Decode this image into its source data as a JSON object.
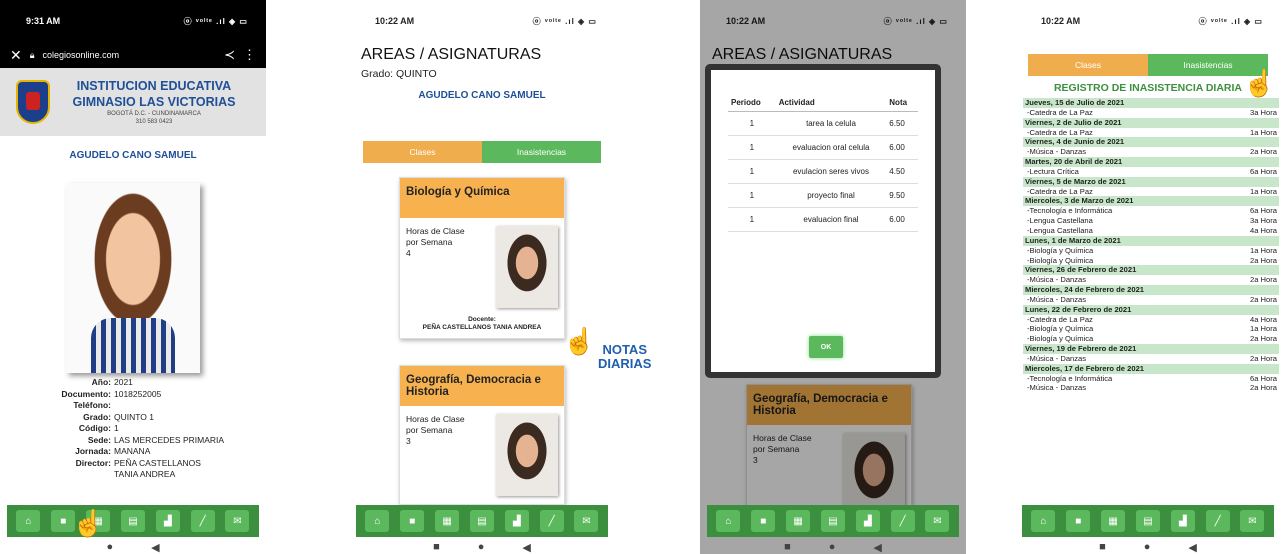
{
  "p1": {
    "time": "9:31 AM",
    "status_icons": "ⓞ ᵛᵒˡᵗᵉ .ıl ◈ ▭",
    "url": "colegiosonline.com",
    "school": {
      "line1": "INSTITUCION EDUCATIVA",
      "line2": "GIMNASIO LAS VICTORIAS",
      "line3": "BOGOTÁ D.C. - CUNDINAMARCA",
      "line4": "310 583 0423"
    },
    "student": "AGUDELO CANO SAMUEL",
    "info": [
      {
        "k": "Año:",
        "v": "2021"
      },
      {
        "k": "Documento:",
        "v": "1018252005"
      },
      {
        "k": "Teléfono:",
        "v": ""
      },
      {
        "k": "Grado:",
        "v": "QUINTO 1"
      },
      {
        "k": "Código:",
        "v": "1"
      },
      {
        "k": "Sede:",
        "v": "LAS MERCEDES PRIMARIA"
      },
      {
        "k": "Jornada:",
        "v": "MANANA"
      },
      {
        "k": "Director:",
        "v": "PEÑA CASTELLANOS"
      },
      {
        "k": "",
        "v": "TANIA ANDREA"
      }
    ]
  },
  "p2": {
    "time": "10:22 AM",
    "title": "AREAS / ASIGNATURAS",
    "grado": "Grado: QUINTO",
    "student": "AGUDELO CANO SAMUEL",
    "tab_clases": "Clases",
    "tab_inasistencias": "Inasistencias",
    "card1": {
      "subject": "Biología y Química",
      "hours_label1": "Horas de Clase",
      "hours_label2": "por Semana",
      "hours": "4",
      "docente_label": "Docente:",
      "docente": "PEÑA CASTELLANOS TANIA ANDREA"
    },
    "card2": {
      "subject": "Geografía, Democracia e Historia",
      "hours_label1": "Horas de Clase",
      "hours_label2": "por Semana",
      "hours": "3"
    },
    "notas_line1": "NOTAS",
    "notas_line2": "DIARIAS"
  },
  "p3": {
    "time": "10:22 AM",
    "title": "AREAS / ASIGNATURAS",
    "headers": {
      "periodo": "Periodo",
      "actividad": "Actividad",
      "nota": "Nota"
    },
    "rows": [
      {
        "p": "1",
        "a": "tarea la celula",
        "n": "6.50"
      },
      {
        "p": "1",
        "a": "evaluacion oral celula",
        "n": "6.00"
      },
      {
        "p": "1",
        "a": "evulacion seres vivos",
        "n": "4.50"
      },
      {
        "p": "1",
        "a": "proyecto final",
        "n": "9.50"
      },
      {
        "p": "1",
        "a": "evaluacion final",
        "n": "6.00"
      }
    ],
    "ok": "OK",
    "card": {
      "subject": "Geografía, Democracia e Historia",
      "hours_label1": "Horas de Clase",
      "hours_label2": "por Semana",
      "hours": "3"
    }
  },
  "p4": {
    "time": "10:22 AM",
    "tab_clases": "Clases",
    "tab_inasistencias": "Inasistencias",
    "title": "REGISTRO DE INASISTENCIA DIARIA",
    "records": [
      {
        "t": "d",
        "text": "Jueves, 15 de Julio de 2021"
      },
      {
        "t": "e",
        "text": "-Catedra de La Paz",
        "h": "3a Hora"
      },
      {
        "t": "d",
        "text": "Viernes, 2 de Julio de 2021"
      },
      {
        "t": "e",
        "text": "-Catedra de La Paz",
        "h": "1a Hora"
      },
      {
        "t": "d",
        "text": "Viernes, 4 de Junio de 2021"
      },
      {
        "t": "e",
        "text": "-Música - Danzas",
        "h": "2a Hora"
      },
      {
        "t": "d",
        "text": "Martes, 20 de Abril de 2021"
      },
      {
        "t": "e",
        "text": "-Lectura Crítica",
        "h": "6a Hora"
      },
      {
        "t": "d",
        "text": "Viernes, 5 de Marzo de 2021"
      },
      {
        "t": "e",
        "text": "-Catedra de La Paz",
        "h": "1a Hora"
      },
      {
        "t": "d",
        "text": "Miercoles, 3 de Marzo de 2021"
      },
      {
        "t": "e",
        "text": "-Tecnología e Informática",
        "h": "6a Hora"
      },
      {
        "t": "e",
        "text": "-Lengua Castellana",
        "h": "3a Hora"
      },
      {
        "t": "e",
        "text": "-Lengua Castellana",
        "h": "4a Hora"
      },
      {
        "t": "d",
        "text": "Lunes, 1 de Marzo de 2021"
      },
      {
        "t": "e",
        "text": "-Biología y Química",
        "h": "1a Hora"
      },
      {
        "t": "e",
        "text": "-Biología y Química",
        "h": "2a Hora"
      },
      {
        "t": "d",
        "text": "Viernes, 26 de Febrero de 2021"
      },
      {
        "t": "e",
        "text": "-Música - Danzas",
        "h": "2a Hora"
      },
      {
        "t": "d",
        "text": "Miercoles, 24 de Febrero de 2021"
      },
      {
        "t": "e",
        "text": "-Música - Danzas",
        "h": "2a Hora"
      },
      {
        "t": "d",
        "text": "Lunes, 22 de Febrero de 2021"
      },
      {
        "t": "e",
        "text": "-Catedra de La Paz",
        "h": "4a Hora"
      },
      {
        "t": "e",
        "text": "-Biología y Química",
        "h": "1a Hora"
      },
      {
        "t": "e",
        "text": "-Biología y Química",
        "h": "2a Hora"
      },
      {
        "t": "d",
        "text": "Viernes, 19 de Febrero de 2021"
      },
      {
        "t": "e",
        "text": "-Música - Danzas",
        "h": "2a Hora"
      },
      {
        "t": "d",
        "text": "Miercoles, 17 de Febrero de 2021"
      },
      {
        "t": "e",
        "text": "-Tecnología e Informática",
        "h": "6a Hora"
      },
      {
        "t": "e",
        "text": "-Música - Danzas",
        "h": "2a Hora"
      }
    ]
  },
  "nav_icons": [
    "home-icon",
    "grid-icon",
    "apps-icon",
    "list-icon",
    "chart-icon",
    "pencil-icon",
    "mail-icon"
  ],
  "nav_glyphs": [
    "⌂",
    "■",
    "▦",
    "▤",
    "▟",
    "╱",
    "✉"
  ],
  "sys_glyphs": [
    "■",
    "●",
    "◀"
  ]
}
